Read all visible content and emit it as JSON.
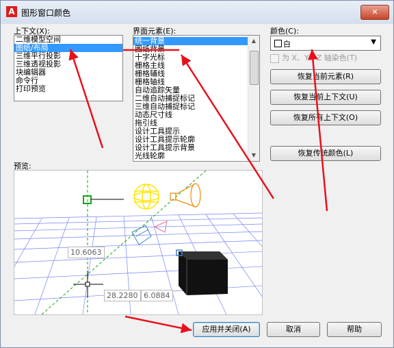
{
  "window": {
    "title": "图形窗口颜色",
    "close": "✕"
  },
  "context": {
    "label": "上下文(X):",
    "items": [
      "二维模型空间",
      "图纸/布局",
      "三维平行投影",
      "三维透视投影",
      "块编辑器",
      "命令行",
      "打印预览"
    ],
    "selected_index": 1
  },
  "elements": {
    "label": "界面元素(E):",
    "items": [
      "统一背景",
      "图纸背景",
      "十字光标",
      "栅格主线",
      "栅格辅线",
      "栅格轴线",
      "自动追踪矢量",
      "二维自动捕捉标记",
      "三维自动捕捉标记",
      "动态尺寸线",
      "拖引线",
      "设计工具提示",
      "设计工具提示轮廓",
      "设计工具提示背景",
      "光线轮廓"
    ],
    "selected_index": 0
  },
  "color": {
    "label": "颜色(C):",
    "value": "白",
    "swatch": "#ffffff"
  },
  "tint": {
    "label": "为 X、Y、Z 轴染色(T)",
    "checked": false
  },
  "buttons": {
    "restore_element": "恢复当前元素(R)",
    "restore_context": "恢复当前上下文(U)",
    "restore_all": "恢复所有上下文(O)",
    "restore_classic": "恢复传统颜色(L)",
    "apply_close": "应用并关闭(A)",
    "cancel": "取消",
    "help": "帮助"
  },
  "preview": {
    "label": "预览:",
    "dim1": "10.6063",
    "dim2": "28.2280",
    "dim3": "6.0884"
  },
  "colors": {
    "selection": "#3399ff",
    "annotation_red": "#e8101b",
    "grid_blue": "#5b6ef0",
    "green": "#15a515",
    "yellow": "#ffe600",
    "orange": "#f08c00"
  }
}
